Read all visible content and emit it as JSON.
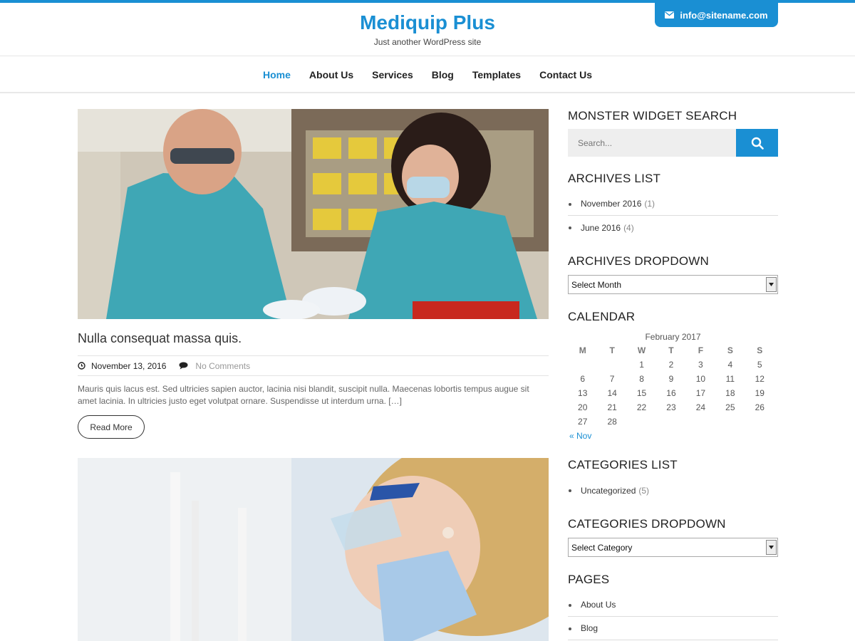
{
  "header": {
    "site_title": "Mediquip Plus",
    "tagline": "Just another WordPress site",
    "email": "info@sitename.com"
  },
  "nav": {
    "items": [
      {
        "label": "Home",
        "active": true
      },
      {
        "label": "About Us"
      },
      {
        "label": "Services"
      },
      {
        "label": "Blog"
      },
      {
        "label": "Templates"
      },
      {
        "label": "Contact Us"
      }
    ]
  },
  "post": {
    "title": "Nulla consequat massa quis.",
    "date": "November 13, 2016",
    "comments": "No Comments",
    "excerpt": "Mauris quis lacus est. Sed ultricies sapien auctor, lacinia nisi blandit, suscipit nulla. Maecenas lobortis tempus augue sit amet lacinia. In ultricies justo eget volutpat ornare. Suspendisse ut interdum urna. […]",
    "read_more": "Read More"
  },
  "sidebar": {
    "search": {
      "title": "MONSTER WIDGET SEARCH",
      "placeholder": "Search..."
    },
    "archives_list": {
      "title": "ARCHIVES LIST",
      "items": [
        {
          "label": "November 2016",
          "count": "(1)"
        },
        {
          "label": "June 2016",
          "count": "(4)"
        }
      ]
    },
    "archives_dropdown": {
      "title": "ARCHIVES DROPDOWN",
      "selected": "Select Month"
    },
    "calendar": {
      "title": "CALENDAR",
      "caption": "February 2017",
      "weekdays": [
        "M",
        "T",
        "W",
        "T",
        "F",
        "S",
        "S"
      ],
      "weeks": [
        [
          "",
          "",
          "1",
          "2",
          "3",
          "4",
          "5"
        ],
        [
          "6",
          "7",
          "8",
          "9",
          "10",
          "11",
          "12"
        ],
        [
          "13",
          "14",
          "15",
          "16",
          "17",
          "18",
          "19"
        ],
        [
          "20",
          "21",
          "22",
          "23",
          "24",
          "25",
          "26"
        ],
        [
          "27",
          "28",
          "",
          "",
          "",
          "",
          ""
        ]
      ],
      "prev": "« Nov"
    },
    "categories_list": {
      "title": "CATEGORIES LIST",
      "items": [
        {
          "label": "Uncategorized",
          "count": "(5)"
        }
      ]
    },
    "categories_dropdown": {
      "title": "CATEGORIES DROPDOWN",
      "selected": "Select Category"
    },
    "pages": {
      "title": "PAGES",
      "items": [
        {
          "label": "About Us"
        },
        {
          "label": "Blog"
        }
      ]
    }
  },
  "colors": {
    "accent": "#1a8fd3"
  }
}
